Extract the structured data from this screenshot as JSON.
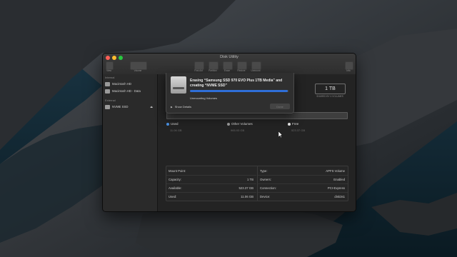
{
  "window": {
    "title": "Disk Utility"
  },
  "toolbar": {
    "buttons": [
      {
        "label": "View"
      },
      {
        "label": "Volume"
      },
      {
        "label": "First Aid"
      },
      {
        "label": "Partition"
      },
      {
        "label": "Erase"
      },
      {
        "label": "Restore"
      },
      {
        "label": "Unmount"
      },
      {
        "label": "Info"
      }
    ]
  },
  "sidebar": {
    "internal_header": "Internal",
    "internal_items": [
      {
        "label": "Macintosh HD"
      },
      {
        "label": "Macintosh HD - Data"
      }
    ],
    "external_header": "External",
    "external_items": [
      {
        "label": "NVME SSD"
      }
    ]
  },
  "disk": {
    "capacity": "1 TB",
    "shared_label": "SHARED BY 4 VOLUMES"
  },
  "legend": [
    {
      "label": "Used",
      "value": "11.06 GB",
      "color": "#4a90e2"
    },
    {
      "label": "Other Volumes",
      "value": "965.93 GB",
      "color": "#9b9b9b"
    },
    {
      "label": "Free",
      "value": "523.37 GB",
      "color": "#e8e8e8"
    }
  ],
  "info_left": [
    {
      "key": "Mount Point:",
      "value": ""
    },
    {
      "key": "Capacity:",
      "value": "1 TB"
    },
    {
      "key": "Available:",
      "value": "523.37 GB"
    },
    {
      "key": "Used:",
      "value": "11.06 GB"
    }
  ],
  "info_right": [
    {
      "key": "Type:",
      "value": "APFS Volume"
    },
    {
      "key": "Owners:",
      "value": "Enabled"
    },
    {
      "key": "Connection:",
      "value": "PCI-Express"
    },
    {
      "key": "Device:",
      "value": "disk3s1"
    }
  ],
  "sheet": {
    "title": "Erasing “Samsung SSD 970 EVO Plus 1TB Media” and creating “NVME SSD”",
    "progress": 0.99,
    "status": "Unmounting Volumes",
    "show_details": "Show Details",
    "done_label": "Done"
  },
  "colors": {
    "accent": "#2f6fd8"
  }
}
